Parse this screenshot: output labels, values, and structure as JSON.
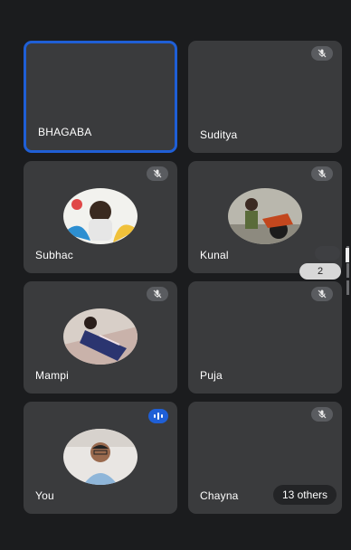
{
  "participants": [
    {
      "name": "BHAGABA",
      "muted": false,
      "speaking": false,
      "active": true
    },
    {
      "name": "Suditya",
      "muted": true
    },
    {
      "name": "Subhac",
      "muted": true
    },
    {
      "name": "Kunal",
      "muted": true
    },
    {
      "name": "Mampi",
      "muted": true
    },
    {
      "name": "Puja",
      "muted": true
    },
    {
      "name": "You",
      "muted": false,
      "speaking": true
    },
    {
      "name": "Chayna",
      "muted": true
    }
  ],
  "others_label": "13 others",
  "pager": {
    "current_page": "2"
  },
  "colors": {
    "accent": "#1f5fd6",
    "tile": "#3a3b3d",
    "background": "#1b1c1e"
  },
  "icons": {
    "mute": "mic-off-icon",
    "speaking": "audio-level-icon"
  }
}
